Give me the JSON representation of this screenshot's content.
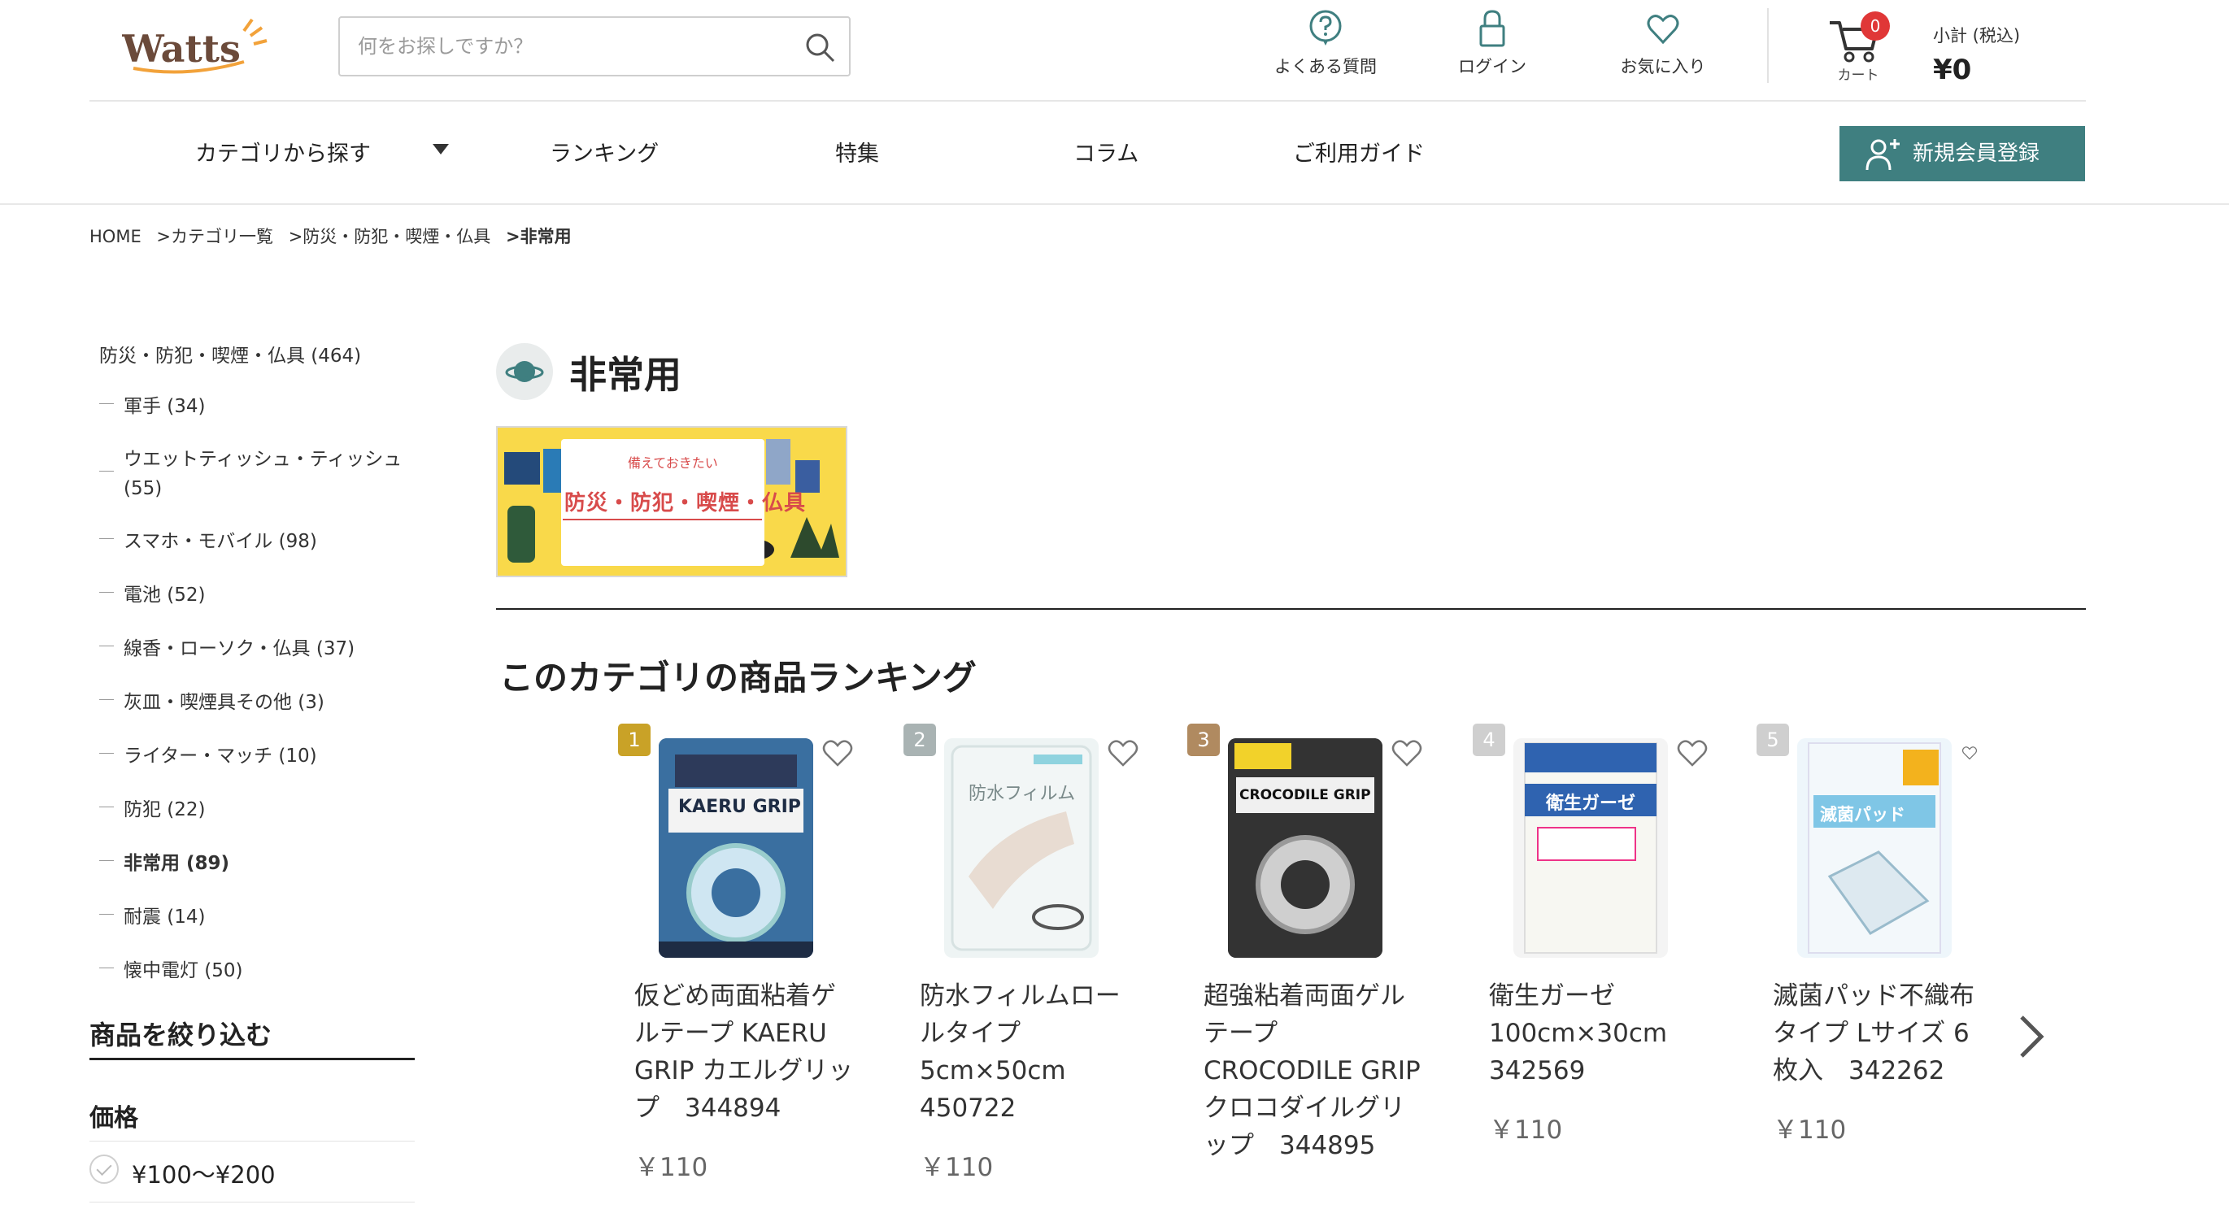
{
  "header": {
    "logo_text": "Watts",
    "search_placeholder": "何をお探しですか？",
    "faq_label": "よくある質問",
    "login_label": "ログイン",
    "favorites_label": "お気に入り",
    "cart_label": "カート",
    "cart_count": "0",
    "subtotal_label": "小計 (税込)",
    "subtotal_value": "¥0"
  },
  "nav": {
    "categories": "カテゴリから探す",
    "ranking": "ランキング",
    "features": "特集",
    "column": "コラム",
    "guide": "ご利用ガイド",
    "register": "新規会員登録"
  },
  "breadcrumb": {
    "home": "HOME",
    "c1": ">カテゴリ一覧",
    "c2": ">防災・防犯・喫煙・仏具",
    "c3": ">非常用"
  },
  "sidebar": {
    "parent": "防災・防犯・喫煙・仏具 (464)",
    "items": [
      {
        "label": "軍手 (34)"
      },
      {
        "label": "ウエットティッシュ・ティッシュ (55)"
      },
      {
        "label": "スマホ・モバイル (98)"
      },
      {
        "label": "電池 (52)"
      },
      {
        "label": "線香・ローソク・仏具 (37)"
      },
      {
        "label": "灰皿・喫煙具その他 (3)"
      },
      {
        "label": "ライター・マッチ (10)"
      },
      {
        "label": "防犯 (22)"
      },
      {
        "label": "非常用 (89)"
      },
      {
        "label": "耐震 (14)"
      },
      {
        "label": "懐中電灯 (50)"
      }
    ],
    "filter_title": "商品を絞り込む",
    "price_title": "価格",
    "price_option": "¥100〜¥200"
  },
  "main": {
    "title": "非常用",
    "banner_sub": "備えておきたい",
    "banner_main": "防災・防犯・喫煙・仏具",
    "ranking_title": "このカテゴリの商品ランキング"
  },
  "products": [
    {
      "rank": "1",
      "rank_color": "#c9a227",
      "name": "仮どめ両面粘着ゲルテープ KAERU GRIP カエルグリップ　344894",
      "price": "￥110",
      "image_text": "KAERU GRIP"
    },
    {
      "rank": "2",
      "rank_color": "#a9b3b3",
      "name": "防水フィルムロールタイプ　5cm×50cm　450722",
      "price": "￥110",
      "image_text": "防水フィルム"
    },
    {
      "rank": "3",
      "rank_color": "#b08a60",
      "name": "超強粘着両面ゲルテープ CROCODILE GRIP クロコダイルグリップ　344895",
      "price": "",
      "image_text": "CROCODILE GRIP"
    },
    {
      "rank": "4",
      "rank_color": "#cfcfcf",
      "name": "衛生ガーゼ　100cm×30cm　342569",
      "price": "￥110",
      "image_text": "衛生ガーゼ"
    },
    {
      "rank": "5",
      "rank_color": "#cfcfcf",
      "name": "滅菌パッド不織布タイプ Lサイズ 6枚入　342262",
      "price": "￥110",
      "image_text": "滅菌パッド"
    }
  ]
}
